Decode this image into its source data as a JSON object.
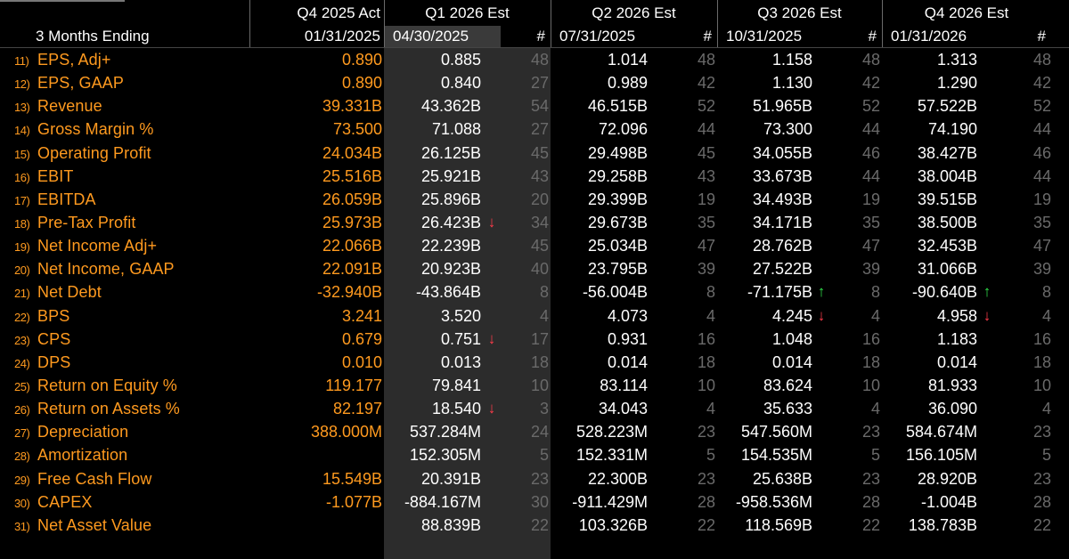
{
  "header": {
    "row1": {
      "act": "Q4 2025 Act",
      "q1": "Q1 2026 Est",
      "q2": "Q2 2026 Est",
      "q3": "Q3 2026 Est",
      "q4": "Q4 2026 Est"
    },
    "row2": {
      "label": "3 Months Ending",
      "act": "01/31/2025",
      "q1": "04/30/2025",
      "q2": "07/31/2025",
      "q3": "10/31/2025",
      "q4": "01/31/2026",
      "count": "#"
    }
  },
  "colors": {
    "label": "#ff9a1f",
    "value": "#ffffff",
    "count": "#6a6a6a",
    "down": "#ff3b4a",
    "up": "#2fe24a"
  },
  "rows": [
    {
      "no": "11)",
      "label": "EPS, Adj+",
      "act": "0.890",
      "q1": "0.885",
      "q1n": "48",
      "q2": "1.014",
      "q2n": "48",
      "q3": "1.158",
      "q3n": "48",
      "q4": "1.313",
      "q4n": "48"
    },
    {
      "no": "12)",
      "label": "EPS, GAAP",
      "act": "0.890",
      "q1": "0.840",
      "q1n": "27",
      "q2": "0.989",
      "q2n": "42",
      "q3": "1.130",
      "q3n": "42",
      "q4": "1.290",
      "q4n": "42"
    },
    {
      "no": "13)",
      "label": "Revenue",
      "act": "39.331B",
      "q1": "43.362B",
      "q1n": "54",
      "q2": "46.515B",
      "q2n": "52",
      "q3": "51.965B",
      "q3n": "52",
      "q4": "57.522B",
      "q4n": "52"
    },
    {
      "no": "14)",
      "label": "Gross Margin %",
      "act": "73.500",
      "q1": "71.088",
      "q1n": "27",
      "q2": "72.096",
      "q2n": "44",
      "q3": "73.300",
      "q3n": "44",
      "q4": "74.190",
      "q4n": "44"
    },
    {
      "no": "15)",
      "label": "Operating Profit",
      "act": "24.034B",
      "q1": "26.125B",
      "q1n": "45",
      "q2": "29.498B",
      "q2n": "45",
      "q3": "34.055B",
      "q3n": "46",
      "q4": "38.427B",
      "q4n": "46"
    },
    {
      "no": "16)",
      "label": "EBIT",
      "act": "25.516B",
      "q1": "25.921B",
      "q1n": "43",
      "q2": "29.258B",
      "q2n": "43",
      "q3": "33.673B",
      "q3n": "44",
      "q4": "38.004B",
      "q4n": "44"
    },
    {
      "no": "17)",
      "label": "EBITDA",
      "act": "26.059B",
      "q1": "25.896B",
      "q1n": "20",
      "q2": "29.399B",
      "q2n": "19",
      "q3": "34.493B",
      "q3n": "19",
      "q4": "39.515B",
      "q4n": "19"
    },
    {
      "no": "18)",
      "label": "Pre-Tax Profit",
      "act": "25.973B",
      "q1": "26.423B",
      "q1n": "34",
      "q1a": "down",
      "q2": "29.673B",
      "q2n": "35",
      "q3": "34.171B",
      "q3n": "35",
      "q4": "38.500B",
      "q4n": "35"
    },
    {
      "no": "19)",
      "label": "Net Income Adj+",
      "act": "22.066B",
      "q1": "22.239B",
      "q1n": "45",
      "q2": "25.034B",
      "q2n": "47",
      "q3": "28.762B",
      "q3n": "47",
      "q4": "32.453B",
      "q4n": "47"
    },
    {
      "no": "20)",
      "label": "Net Income, GAAP",
      "act": "22.091B",
      "q1": "20.923B",
      "q1n": "40",
      "q2": "23.795B",
      "q2n": "39",
      "q3": "27.522B",
      "q3n": "39",
      "q4": "31.066B",
      "q4n": "39"
    },
    {
      "no": "21)",
      "label": "Net Debt",
      "act": "-32.940B",
      "q1": "-43.864B",
      "q1n": "8",
      "q2": "-56.004B",
      "q2n": "8",
      "q3": "-71.175B",
      "q3n": "8",
      "q3a": "up",
      "q4": "-90.640B",
      "q4n": "8",
      "q4a": "up"
    },
    {
      "no": "22)",
      "label": "BPS",
      "act": "3.241",
      "q1": "3.520",
      "q1n": "4",
      "q2": "4.073",
      "q2n": "4",
      "q3": "4.245",
      "q3n": "4",
      "q3a": "down",
      "q4": "4.958",
      "q4n": "4",
      "q4a": "down"
    },
    {
      "no": "23)",
      "label": "CPS",
      "act": "0.679",
      "q1": "0.751",
      "q1n": "17",
      "q1a": "down",
      "q2": "0.931",
      "q2n": "16",
      "q3": "1.048",
      "q3n": "16",
      "q4": "1.183",
      "q4n": "16"
    },
    {
      "no": "24)",
      "label": "DPS",
      "act": "0.010",
      "q1": "0.013",
      "q1n": "18",
      "q2": "0.014",
      "q2n": "18",
      "q3": "0.014",
      "q3n": "18",
      "q4": "0.014",
      "q4n": "18"
    },
    {
      "no": "25)",
      "label": "Return on Equity %",
      "act": "119.177",
      "q1": "79.841",
      "q1n": "10",
      "q2": "83.114",
      "q2n": "10",
      "q3": "83.624",
      "q3n": "10",
      "q4": "81.933",
      "q4n": "10"
    },
    {
      "no": "26)",
      "label": "Return on Assets %",
      "act": "82.197",
      "q1": "18.540",
      "q1n": "3",
      "q1a": "down",
      "q2": "34.043",
      "q2n": "4",
      "q3": "35.633",
      "q3n": "4",
      "q4": "36.090",
      "q4n": "4"
    },
    {
      "no": "27)",
      "label": "Depreciation",
      "act": "388.000M",
      "q1": "537.284M",
      "q1n": "24",
      "q2": "528.223M",
      "q2n": "23",
      "q3": "547.560M",
      "q3n": "23",
      "q4": "584.674M",
      "q4n": "23"
    },
    {
      "no": "28)",
      "label": "Amortization",
      "act": "",
      "q1": "152.305M",
      "q1n": "5",
      "q2": "152.331M",
      "q2n": "5",
      "q3": "154.535M",
      "q3n": "5",
      "q4": "156.105M",
      "q4n": "5"
    },
    {
      "no": "29)",
      "label": "Free Cash Flow",
      "act": "15.549B",
      "q1": "20.391B",
      "q1n": "23",
      "q2": "22.300B",
      "q2n": "23",
      "q3": "25.638B",
      "q3n": "23",
      "q4": "28.920B",
      "q4n": "23"
    },
    {
      "no": "30)",
      "label": "CAPEX",
      "act": "-1.077B",
      "q1": "-884.167M",
      "q1n": "30",
      "q2": "-911.429M",
      "q2n": "28",
      "q3": "-958.536M",
      "q3n": "28",
      "q4": "-1.004B",
      "q4n": "28"
    },
    {
      "no": "31)",
      "label": "Net Asset Value",
      "act": "",
      "q1": "88.839B",
      "q1n": "22",
      "q2": "103.326B",
      "q2n": "22",
      "q3": "118.569B",
      "q3n": "22",
      "q4": "138.783B",
      "q4n": "22"
    }
  ],
  "icons": {
    "down": "arrow-down-icon",
    "up": "arrow-up-icon"
  }
}
